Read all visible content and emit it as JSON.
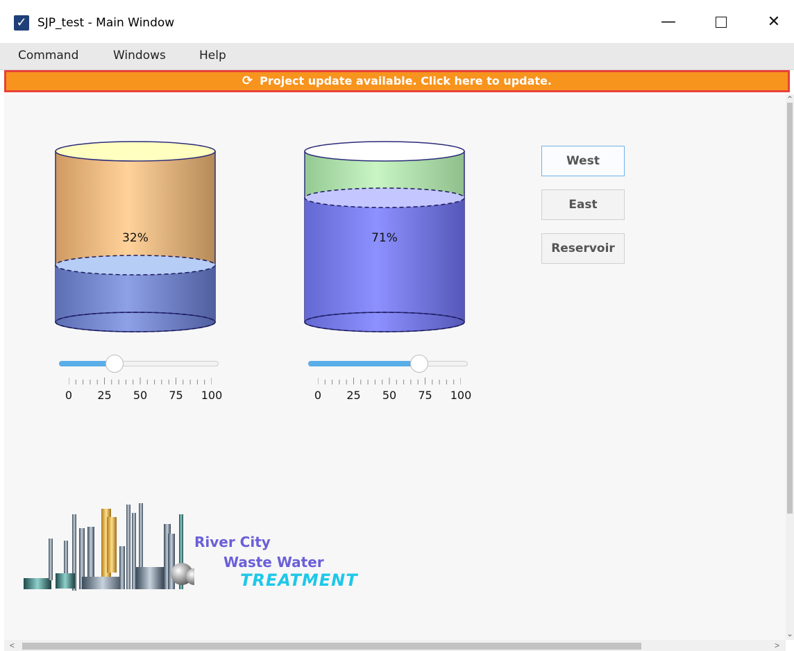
{
  "window": {
    "title": "SJP_test - Main Window",
    "app_icon": "checkmark-icon",
    "controls": {
      "minimize": "—",
      "maximize": "☐",
      "close": "✕"
    }
  },
  "menu": {
    "items": [
      "Command",
      "Windows",
      "Help"
    ]
  },
  "banner": {
    "text": "Project update available. Click here to update.",
    "icon": "refresh-icon",
    "color": "#f7941d",
    "border_color": "#e8413a"
  },
  "tanks": [
    {
      "label": "32%",
      "level": 0.32,
      "liquid_color": "#6e80c8",
      "shell_color": "#e0a870"
    },
    {
      "label": "71%",
      "level": 0.71,
      "liquid_color": "#7b7ff0",
      "shell_color": "#a9d9a2"
    }
  ],
  "sliders": [
    {
      "value": 32,
      "min": 0,
      "max": 100,
      "tick_labels": [
        "0",
        "25",
        "50",
        "75",
        "100"
      ],
      "fill_color": "#5aaee8"
    },
    {
      "value": 71,
      "min": 0,
      "max": 100,
      "tick_labels": [
        "0",
        "25",
        "50",
        "75",
        "100"
      ],
      "fill_color": "#5aaee8"
    }
  ],
  "buttons": [
    {
      "label": "West",
      "selected": true
    },
    {
      "label": "East",
      "selected": false
    },
    {
      "label": "Reservoir",
      "selected": false
    }
  ],
  "logo": {
    "line1": "River City",
    "line2": "Waste Water",
    "line3": "TREATMENT"
  }
}
